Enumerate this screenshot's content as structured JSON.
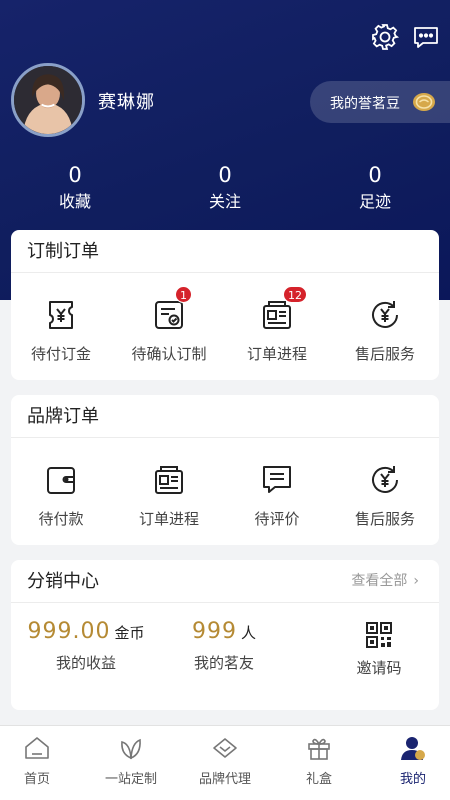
{
  "header": {
    "username": "赛琳娜",
    "points_label": "我的誉茗豆",
    "stats": [
      {
        "value": "0",
        "label": "收藏"
      },
      {
        "value": "0",
        "label": "关注"
      },
      {
        "value": "0",
        "label": "足迹"
      }
    ]
  },
  "custom_orders": {
    "title": "订制订单",
    "items": [
      {
        "label": "待付订金",
        "badge": ""
      },
      {
        "label": "待确认订制",
        "badge": "1"
      },
      {
        "label": "订单进程",
        "badge": "12"
      },
      {
        "label": "售后服务",
        "badge": ""
      }
    ]
  },
  "brand_orders": {
    "title": "品牌订单",
    "items": [
      {
        "label": "待付款"
      },
      {
        "label": "订单进程"
      },
      {
        "label": "待评价"
      },
      {
        "label": "售后服务"
      }
    ]
  },
  "distribution": {
    "title": "分销中心",
    "view_all": "查看全部",
    "earnings": {
      "value": "999.00",
      "unit": "金币",
      "label": "我的收益"
    },
    "friends": {
      "value": "999",
      "unit": "人",
      "label": "我的茗友"
    },
    "invite": {
      "label": "邀请码"
    }
  },
  "tabbar": {
    "tabs": [
      {
        "label": "首页"
      },
      {
        "label": "一站定制"
      },
      {
        "label": "品牌代理"
      },
      {
        "label": "礼盒"
      },
      {
        "label": "我的"
      }
    ],
    "active_index": 4
  },
  "colors": {
    "header_navy": "#101e5e",
    "gold_accent": "#b58a34",
    "badge_red": "#d5232b",
    "active_tab": "#1a2470"
  }
}
